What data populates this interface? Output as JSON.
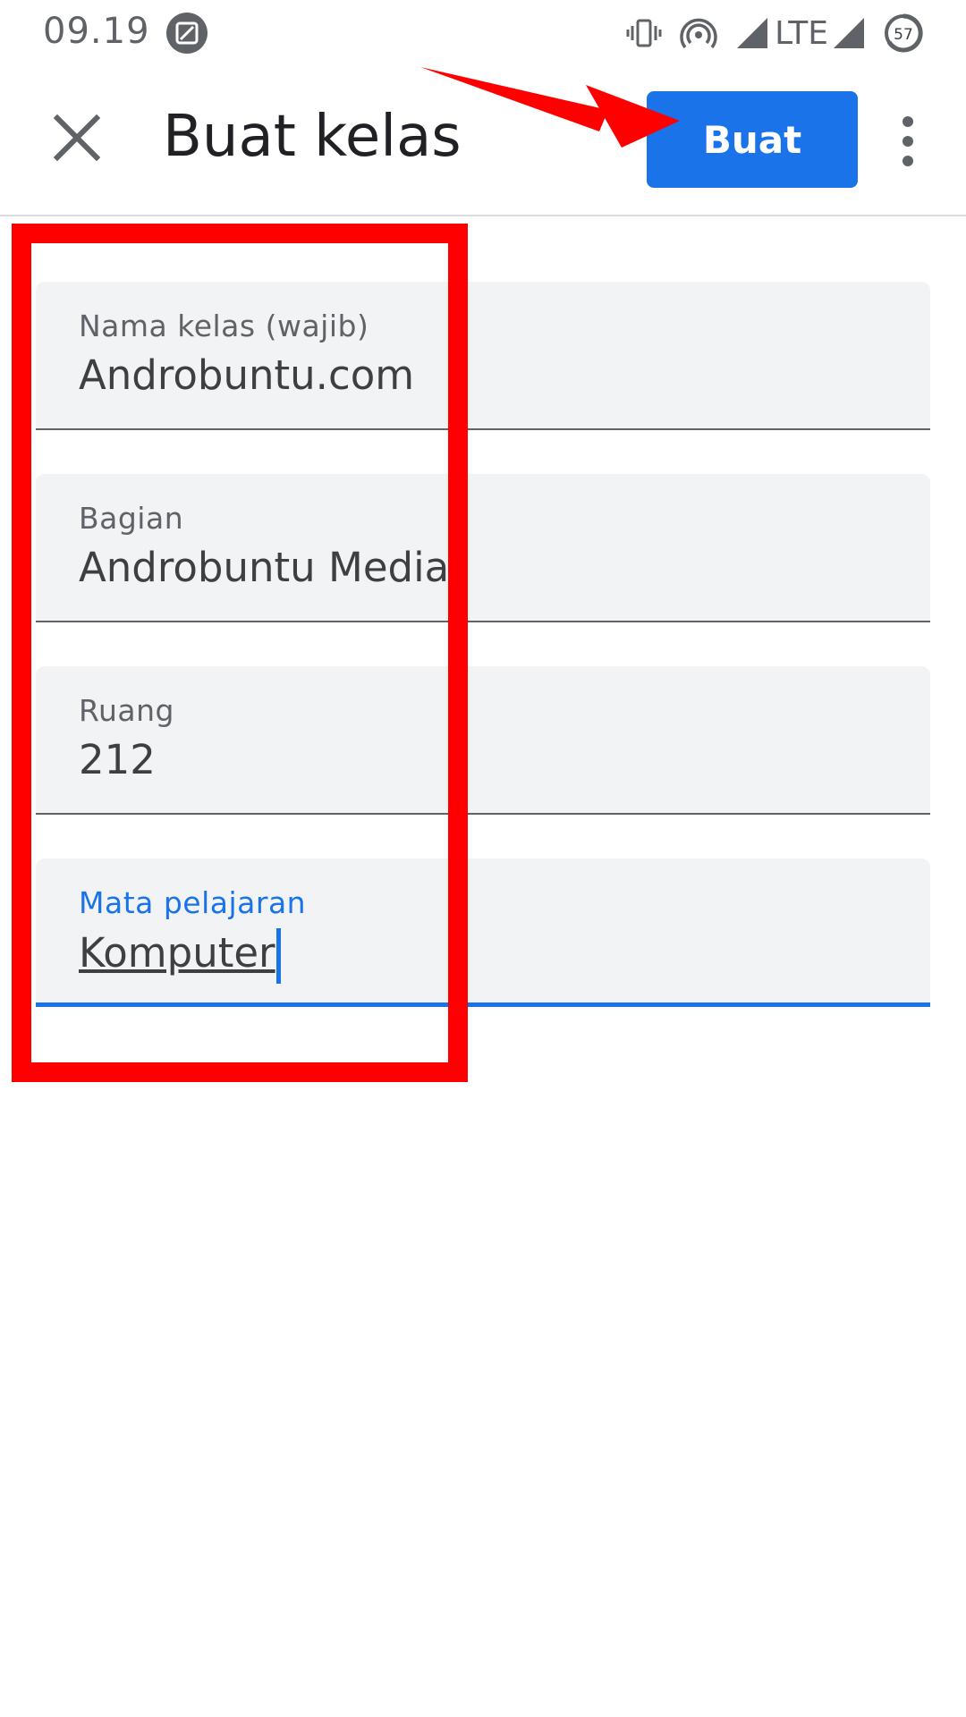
{
  "status_bar": {
    "time": "09.19",
    "network": "LTE",
    "battery": "57",
    "icons": [
      "screenshot-icon",
      "vibrate-icon",
      "hotspot-icon",
      "signal-icon",
      "battery-icon"
    ]
  },
  "app_bar": {
    "title": "Buat kelas",
    "create_label": "Buat",
    "close_icon": "close-icon",
    "more_icon": "more-vert-icon"
  },
  "form": {
    "fields": [
      {
        "label": "Nama kelas (wajib)",
        "value": "Androbuntu.com",
        "focused": false
      },
      {
        "label": "Bagian",
        "value": "Androbuntu Media",
        "focused": false
      },
      {
        "label": "Ruang",
        "value": "212",
        "focused": false
      },
      {
        "label": "Mata pelajaran",
        "value": "Komputer",
        "focused": true
      }
    ]
  },
  "colors": {
    "primary": "#1a73e8",
    "field_bg": "#f1f3f4",
    "annotation": "#ff0000",
    "text_primary": "#202124",
    "text_secondary": "#5f6368"
  }
}
